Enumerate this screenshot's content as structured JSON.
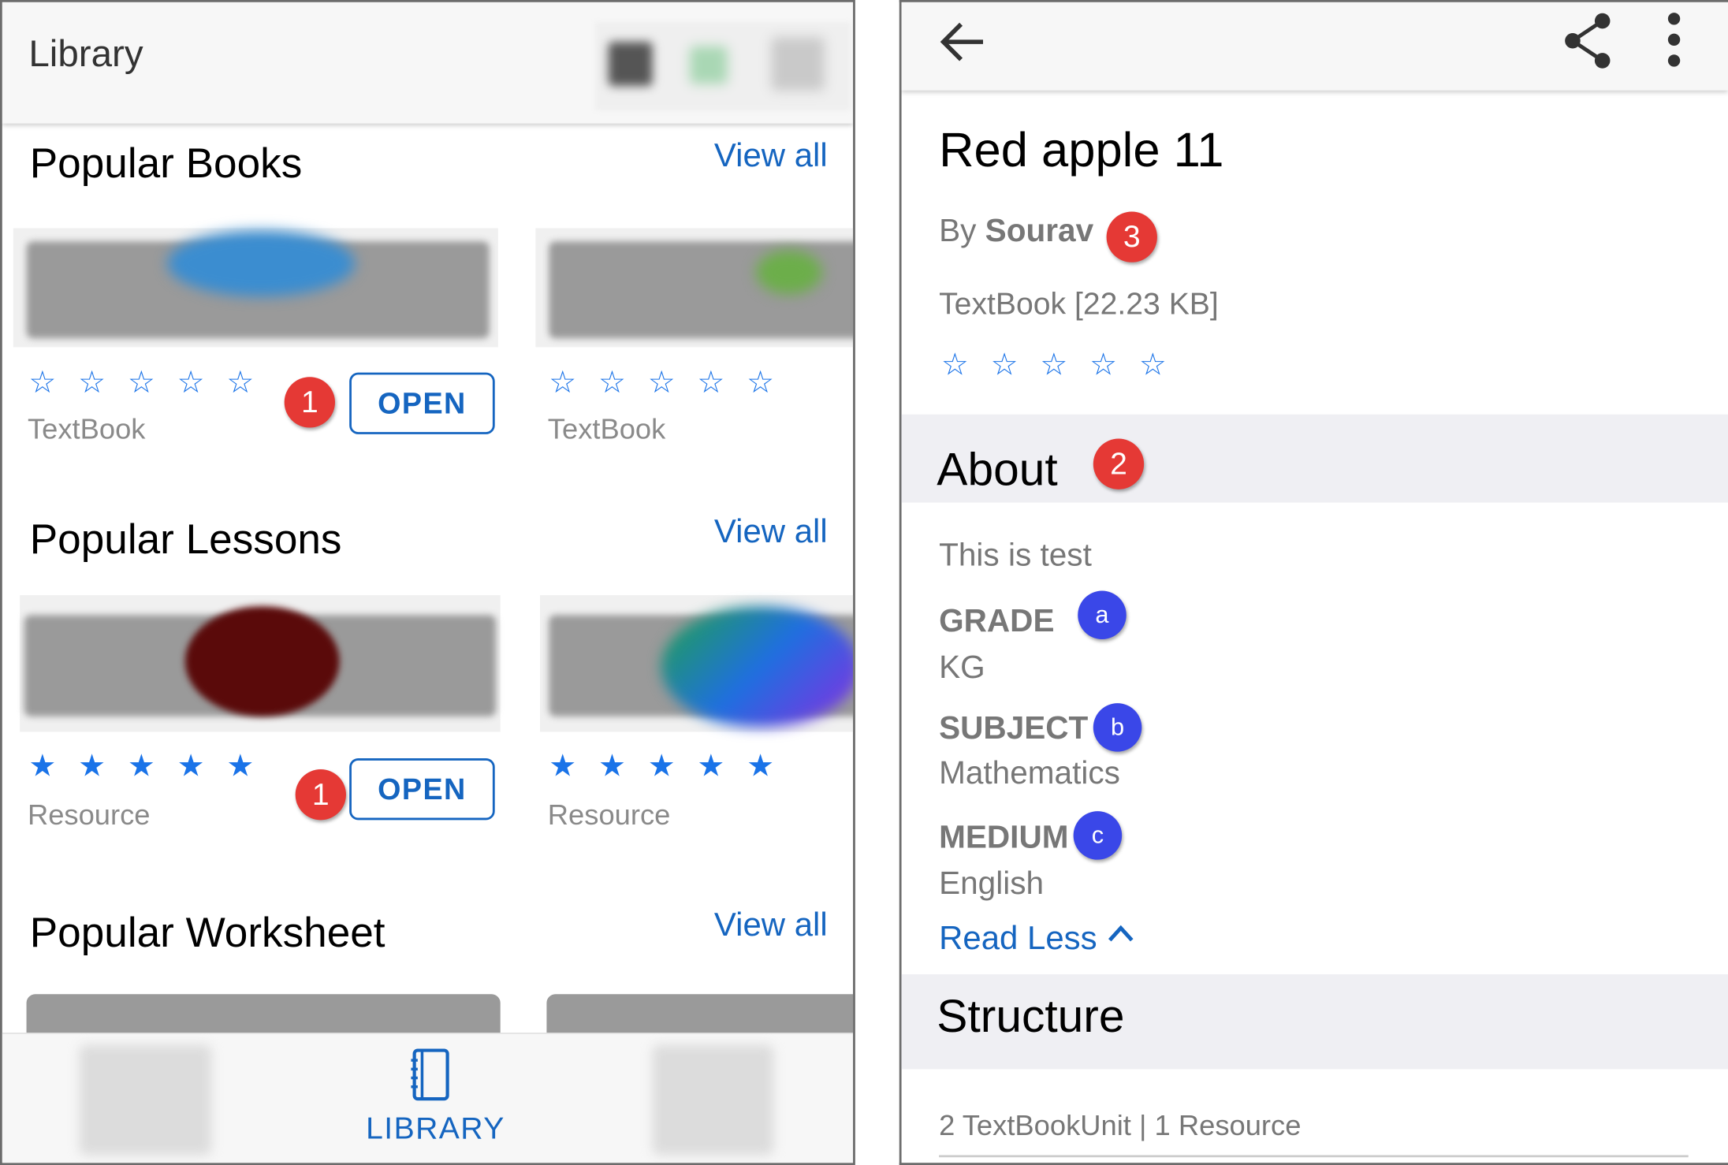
{
  "left": {
    "appbar": {
      "title": "Library"
    },
    "sections": [
      {
        "title": "Popular Books",
        "view_all": "View all"
      },
      {
        "title": "Popular Lessons",
        "view_all": "View all"
      },
      {
        "title": "Popular Worksheet",
        "view_all": "View all"
      }
    ],
    "books": [
      {
        "type": "TextBook",
        "rating_stars": "☆ ☆ ☆ ☆ ☆",
        "rating": 0
      },
      {
        "type": "TextBook",
        "rating_stars": "☆ ☆ ☆ ☆ ☆",
        "rating": 0
      }
    ],
    "lessons": [
      {
        "type": "Resource",
        "rating_stars": "★ ★ ★ ★ ★",
        "rating": 5
      },
      {
        "type": "Resource",
        "rating_stars": "★ ★ ★ ★ ★",
        "rating": 5
      }
    ],
    "open_label": "OPEN",
    "callouts": {
      "open_books": "1",
      "open_lessons": "1"
    },
    "bottom_nav": {
      "active_label": "LIBRARY"
    }
  },
  "right": {
    "title": "Red apple 11",
    "author_prefix": "By",
    "author": "Sourav",
    "meta": "TextBook [22.23 KB]",
    "rating_stars": "☆ ☆ ☆ ☆ ☆",
    "rating": 0,
    "about_title": "About",
    "description": "This is test",
    "fields": [
      {
        "label": "GRADE",
        "value": "KG",
        "callout": "a"
      },
      {
        "label": "SUBJECT",
        "value": "Mathematics",
        "callout": "b"
      },
      {
        "label": "MEDIUM",
        "value": "English",
        "callout": "c"
      }
    ],
    "read_less": "Read Less",
    "structure_title": "Structure",
    "structure_summary": "2 TextBookUnit | 1 Resource",
    "callouts": {
      "about": "2",
      "author": "3"
    }
  },
  "colors": {
    "accent_blue": "#1565c0",
    "star_blue": "#1a73e8",
    "callout_red": "#e53935",
    "callout_blue": "#3a47e8"
  }
}
